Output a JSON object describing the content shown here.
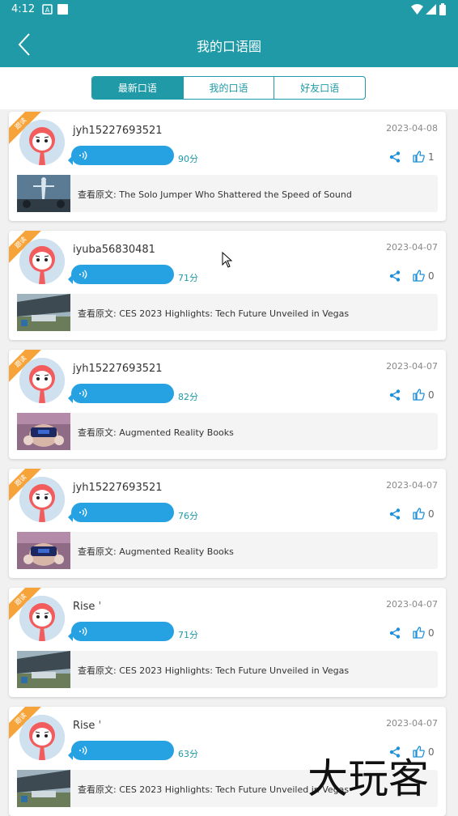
{
  "status_bar": {
    "time": "4:12"
  },
  "header": {
    "title": "我的口语圈"
  },
  "tabs": [
    {
      "label": "最新口语",
      "active": true
    },
    {
      "label": "我的口语",
      "active": false
    },
    {
      "label": "好友口语",
      "active": false
    }
  ],
  "posts": [
    {
      "ribbon": "跟读",
      "username": "jyh15227693521",
      "date": "2023-04-08",
      "score": "90分",
      "likes": "1",
      "source": "查看原文: The Solo Jumper Who Shattered the Speed of Sound",
      "thumb": "jumper"
    },
    {
      "ribbon": "跟读",
      "username": "iyuba56830481",
      "date": "2023-04-07",
      "score": "71分",
      "likes": "0",
      "source": "查看原文: CES 2023 Highlights: Tech Future Unveiled in Vegas",
      "thumb": "ces"
    },
    {
      "ribbon": "跟读",
      "username": "jyh15227693521",
      "date": "2023-04-07",
      "score": "82分",
      "likes": "0",
      "source": "查看原文: Augmented Reality Books",
      "thumb": "vr"
    },
    {
      "ribbon": "跟读",
      "username": "jyh15227693521",
      "date": "2023-04-07",
      "score": "76分",
      "likes": "0",
      "source": "查看原文: Augmented Reality Books",
      "thumb": "vr"
    },
    {
      "ribbon": "跟读",
      "username": "Rise ˈ",
      "date": "2023-04-07",
      "score": "71分",
      "likes": "0",
      "source": "查看原文: CES 2023 Highlights: Tech Future Unveiled in Vegas",
      "thumb": "ces"
    },
    {
      "ribbon": "跟读",
      "username": "Rise ˈ",
      "date": "2023-04-07",
      "score": "63分",
      "likes": "0",
      "source": "查看原文: CES 2023 Highlights: Tech Future Unveiled in Vegas",
      "thumb": "ces"
    }
  ],
  "watermark": "大玩客",
  "colors": {
    "primary": "#1f9aa6",
    "voice": "#26a2e3",
    "ribbon": "#f6a33a"
  }
}
